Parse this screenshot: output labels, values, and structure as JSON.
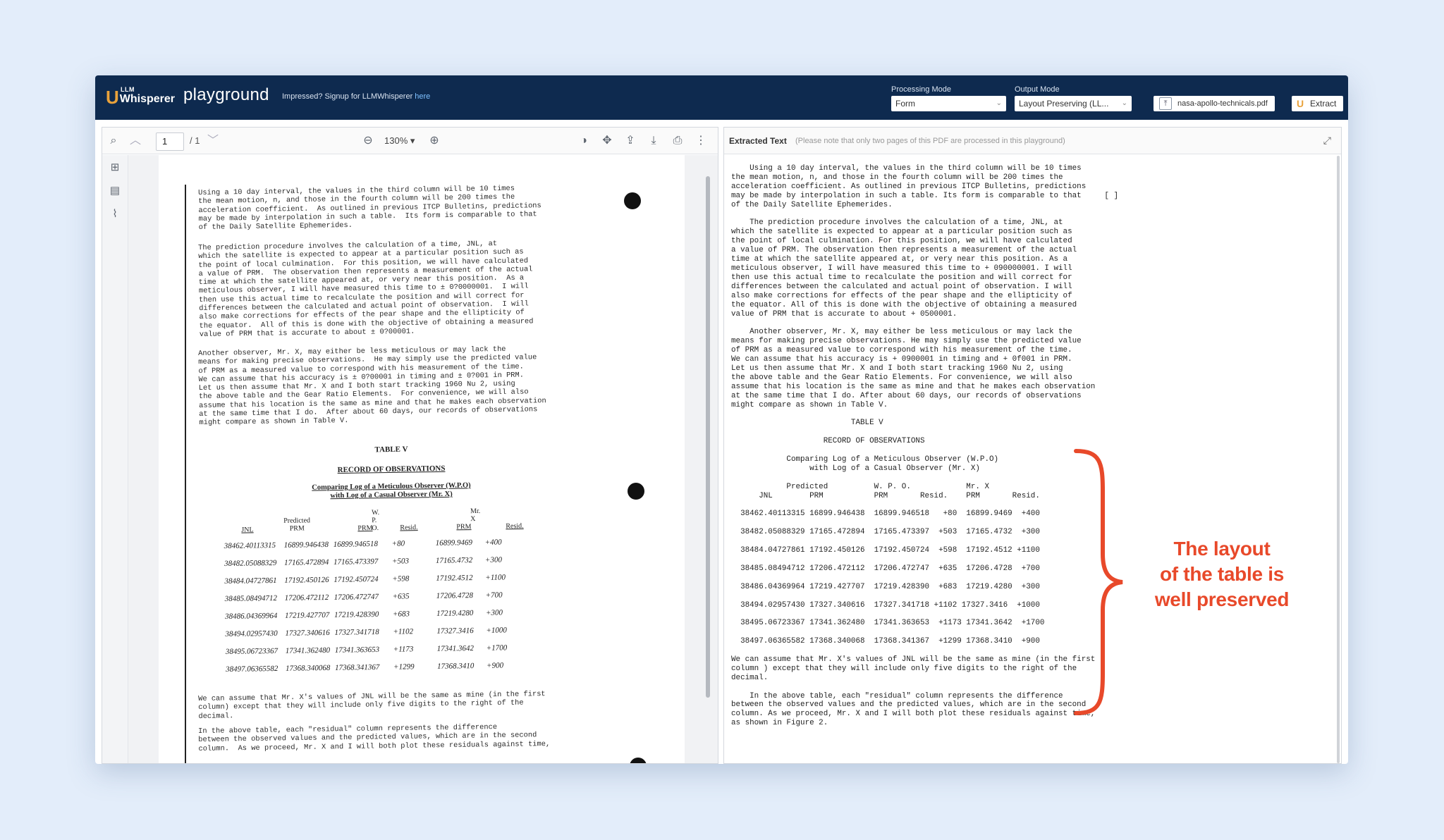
{
  "header": {
    "logo_top": "LLM",
    "logo_main": "Whisperer",
    "title": "playground",
    "tagline": "Impressed? Signup for LLMWhisperer",
    "tagline_link": "here",
    "processing_mode_label": "Processing Mode",
    "processing_mode_value": "Form",
    "output_mode_label": "Output Mode",
    "output_mode_value": "Layout Preserving (LL...",
    "file_name": "nasa-apollo-technicals.pdf",
    "extract_label": "Extract",
    "accent_color": "#e9a23b"
  },
  "viewer": {
    "page_number": "1",
    "page_total": "/ 1",
    "zoom": "130% ▾"
  },
  "scan": {
    "para1": "Using a 10 day interval, the values in the third column will be 10 times\nthe mean motion, n, and those in the fourth column will be 200 times the\nacceleration coefficient.  As outlined in previous ITCP Bulletins, predictions\nmay be made by interpolation in such a table.  Its form is comparable to that\nof the Daily Satellite Ephemerides.",
    "para2": "The prediction procedure involves the calculation of a time, JNL, at\nwhich the satellite is expected to appear at a particular position such as\nthe point of local culmination.  For this position, we will have calculated\na value of PRM.  The observation then represents a measurement of the actual\ntime at which the satellite appeared at, or very near this position.  As a\nmeticulous observer, I will have measured this time to ± 0?0000001.  I will\nthen use this actual time to recalculate the position and will correct for\ndifferences between the calculated and actual point of observation.  I will\nalso make corrections for effects of the pear shape and the ellipticity of\nthe equator.  All of this is done with the objective of obtaining a measured\nvalue of PRM that is accurate to about ± 0?00001.",
    "para3": "Another observer, Mr. X, may either be less meticulous or may lack the\nmeans for making precise observations.  He may simply use the predicted value\nof PRM as a measured value to correspond with his measurement of the time.\nWe can assume that his accuracy is ± 0?00001 in timing and ± 0?001 in PRM.\nLet us then assume that Mr. X and I both start tracking 1960 Nu 2, using\nthe above table and the Gear Ratio Elements.  For convenience, we will also\nassume that his location is the same as mine and that he makes each observation\nat the same time that I do.  After about 60 days, our records of observations\nmight compare as shown in Table V.",
    "table_title": "TABLE V",
    "table_subtitle": "RECORD OF OBSERVATIONS",
    "table_caption": "Comparing Log of a Meticulous Observer (W.P.O)\nwith Log of a Casual Observer (Mr. X)",
    "para4": "We can assume that Mr. X's values of JNL will be the same as mine (in the first\ncolumn) except that they will include only five digits to the right of the\ndecimal.",
    "para5": "In the above table, each \"residual\" column represents the difference\nbetween the observed values and the predicted values, which are in the second\ncolumn.  As we proceed, Mr. X and I will both plot these residuals against time,"
  },
  "table": {
    "group_headers": [
      "W. P. O.",
      "Mr. X"
    ],
    "headers": [
      "JNL",
      "Predicted\nPRM",
      "PRM",
      "Resid.",
      "PRM",
      "Resid."
    ],
    "rows": [
      [
        "38462.40113315",
        "16899.946438",
        "16899.946518",
        "+80",
        "16899.9469",
        "+400"
      ],
      [
        "38482.05088329",
        "17165.472894",
        "17165.473397",
        "+503",
        "17165.4732",
        "+300"
      ],
      [
        "38484.04727861",
        "17192.450126",
        "17192.450724",
        "+598",
        "17192.4512",
        "+1100"
      ],
      [
        "38485.08494712",
        "17206.472112",
        "17206.472747",
        "+635",
        "17206.4728",
        "+700"
      ],
      [
        "38486.04369964",
        "17219.427707",
        "17219.428390",
        "+683",
        "17219.4280",
        "+300"
      ],
      [
        "38494.02957430",
        "17327.340616",
        "17327.341718",
        "+1102",
        "17327.3416",
        "+1000"
      ],
      [
        "38495.06723367",
        "17341.362480",
        "17341.363653",
        "+1173",
        "17341.3642",
        "+1700"
      ],
      [
        "38497.06365582",
        "17368.340068",
        "17368.341367",
        "+1299",
        "17368.3410",
        "+900"
      ]
    ]
  },
  "extracted": {
    "title": "Extracted Text",
    "note": "(Please note that only two pages of this PDF are processed in this playground)",
    "text": "    Using a 10 day interval, the values in the third column will be 10 times\nthe mean motion, n, and those in the fourth column will be 200 times the\nacceleration coefficient. As outlined in previous ITCP Bulletins, predictions\nmay be made by interpolation in such a table. Its form is comparable to that     [ ]\nof the Daily Satellite Ephemerides.\n\n    The prediction procedure involves the calculation of a time, JNL, at\nwhich the satellite is expected to appear at a particular position such as\nthe point of local culmination. For this position, we will have calculated\na value of PRM. The observation then represents a measurement of the actual\ntime at which the satellite appeared at, or very near this position. As a\nmeticulous observer, I will have measured this time to + 090000001. I will\nthen use this actual time to recalculate the position and will correct for\ndifferences between the calculated and actual point of observation. I will\nalso make corrections for effects of the pear shape and the ellipticity of\nthe equator. All of this is done with the objective of obtaining a measured\nvalue of PRM that is accurate to about + 0500001.\n\n    Another observer, Mr. X, may either be less meticulous or may lack the\nmeans for making precise observations. He may simply use the predicted value\nof PRM as a measured value to correspond with his measurement of the time.\nWe can assume that his accuracy is + 0900001 in timing and + 0f001 in PRM.\nLet us then assume that Mr. X and I both start tracking 1960 Nu 2, using\nthe above table and the Gear Ratio Elements. For convenience, we will also\nassume that his location is the same as mine and that he makes each observation\nat the same time that I do. After about 60 days, our records of observations\nmight compare as shown in Table V.\n\n                          TABLE V\n\n                    RECORD OF OBSERVATIONS\n\n            Comparing Log of a Meticulous Observer (W.P.O)\n                 with Log of a Casual Observer (Mr. X)\n\n            Predicted          W. P. O.            Mr. X\n      JNL        PRM           PRM       Resid.    PRM       Resid.\n\n  38462.40113315 16899.946438  16899.946518   +80  16899.9469  +400\n\n  38482.05088329 17165.472894  17165.473397  +503  17165.4732  +300\n\n  38484.04727861 17192.450126  17192.450724  +598  17192.4512 +1100\n\n  38485.08494712 17206.472112  17206.472747  +635  17206.4728  +700\n\n  38486.04369964 17219.427707  17219.428390  +683  17219.4280  +300\n\n  38494.02957430 17327.340616  17327.341718 +1102 17327.3416  +1000\n\n  38495.06723367 17341.362480  17341.363653  +1173 17341.3642  +1700\n\n  38497.06365582 17368.340068  17368.341367  +1299 17368.3410  +900\n\nWe can assume that Mr. X's values of JNL will be the same as mine (in the first\ncolumn ) except that they will include only five digits to the right of the\ndecimal.\n\n    In the above table, each \"residual\" column represents the difference\nbetween the observed values and the predicted values, which are in the second\ncolumn. As we proceed, Mr. X and I will both plot these residuals against time,\nas shown in Figure 2."
  },
  "annotation": {
    "text_line1": "The layout",
    "text_line2": "of the table is",
    "text_line3": "well preserved",
    "color": "#e8492a"
  }
}
